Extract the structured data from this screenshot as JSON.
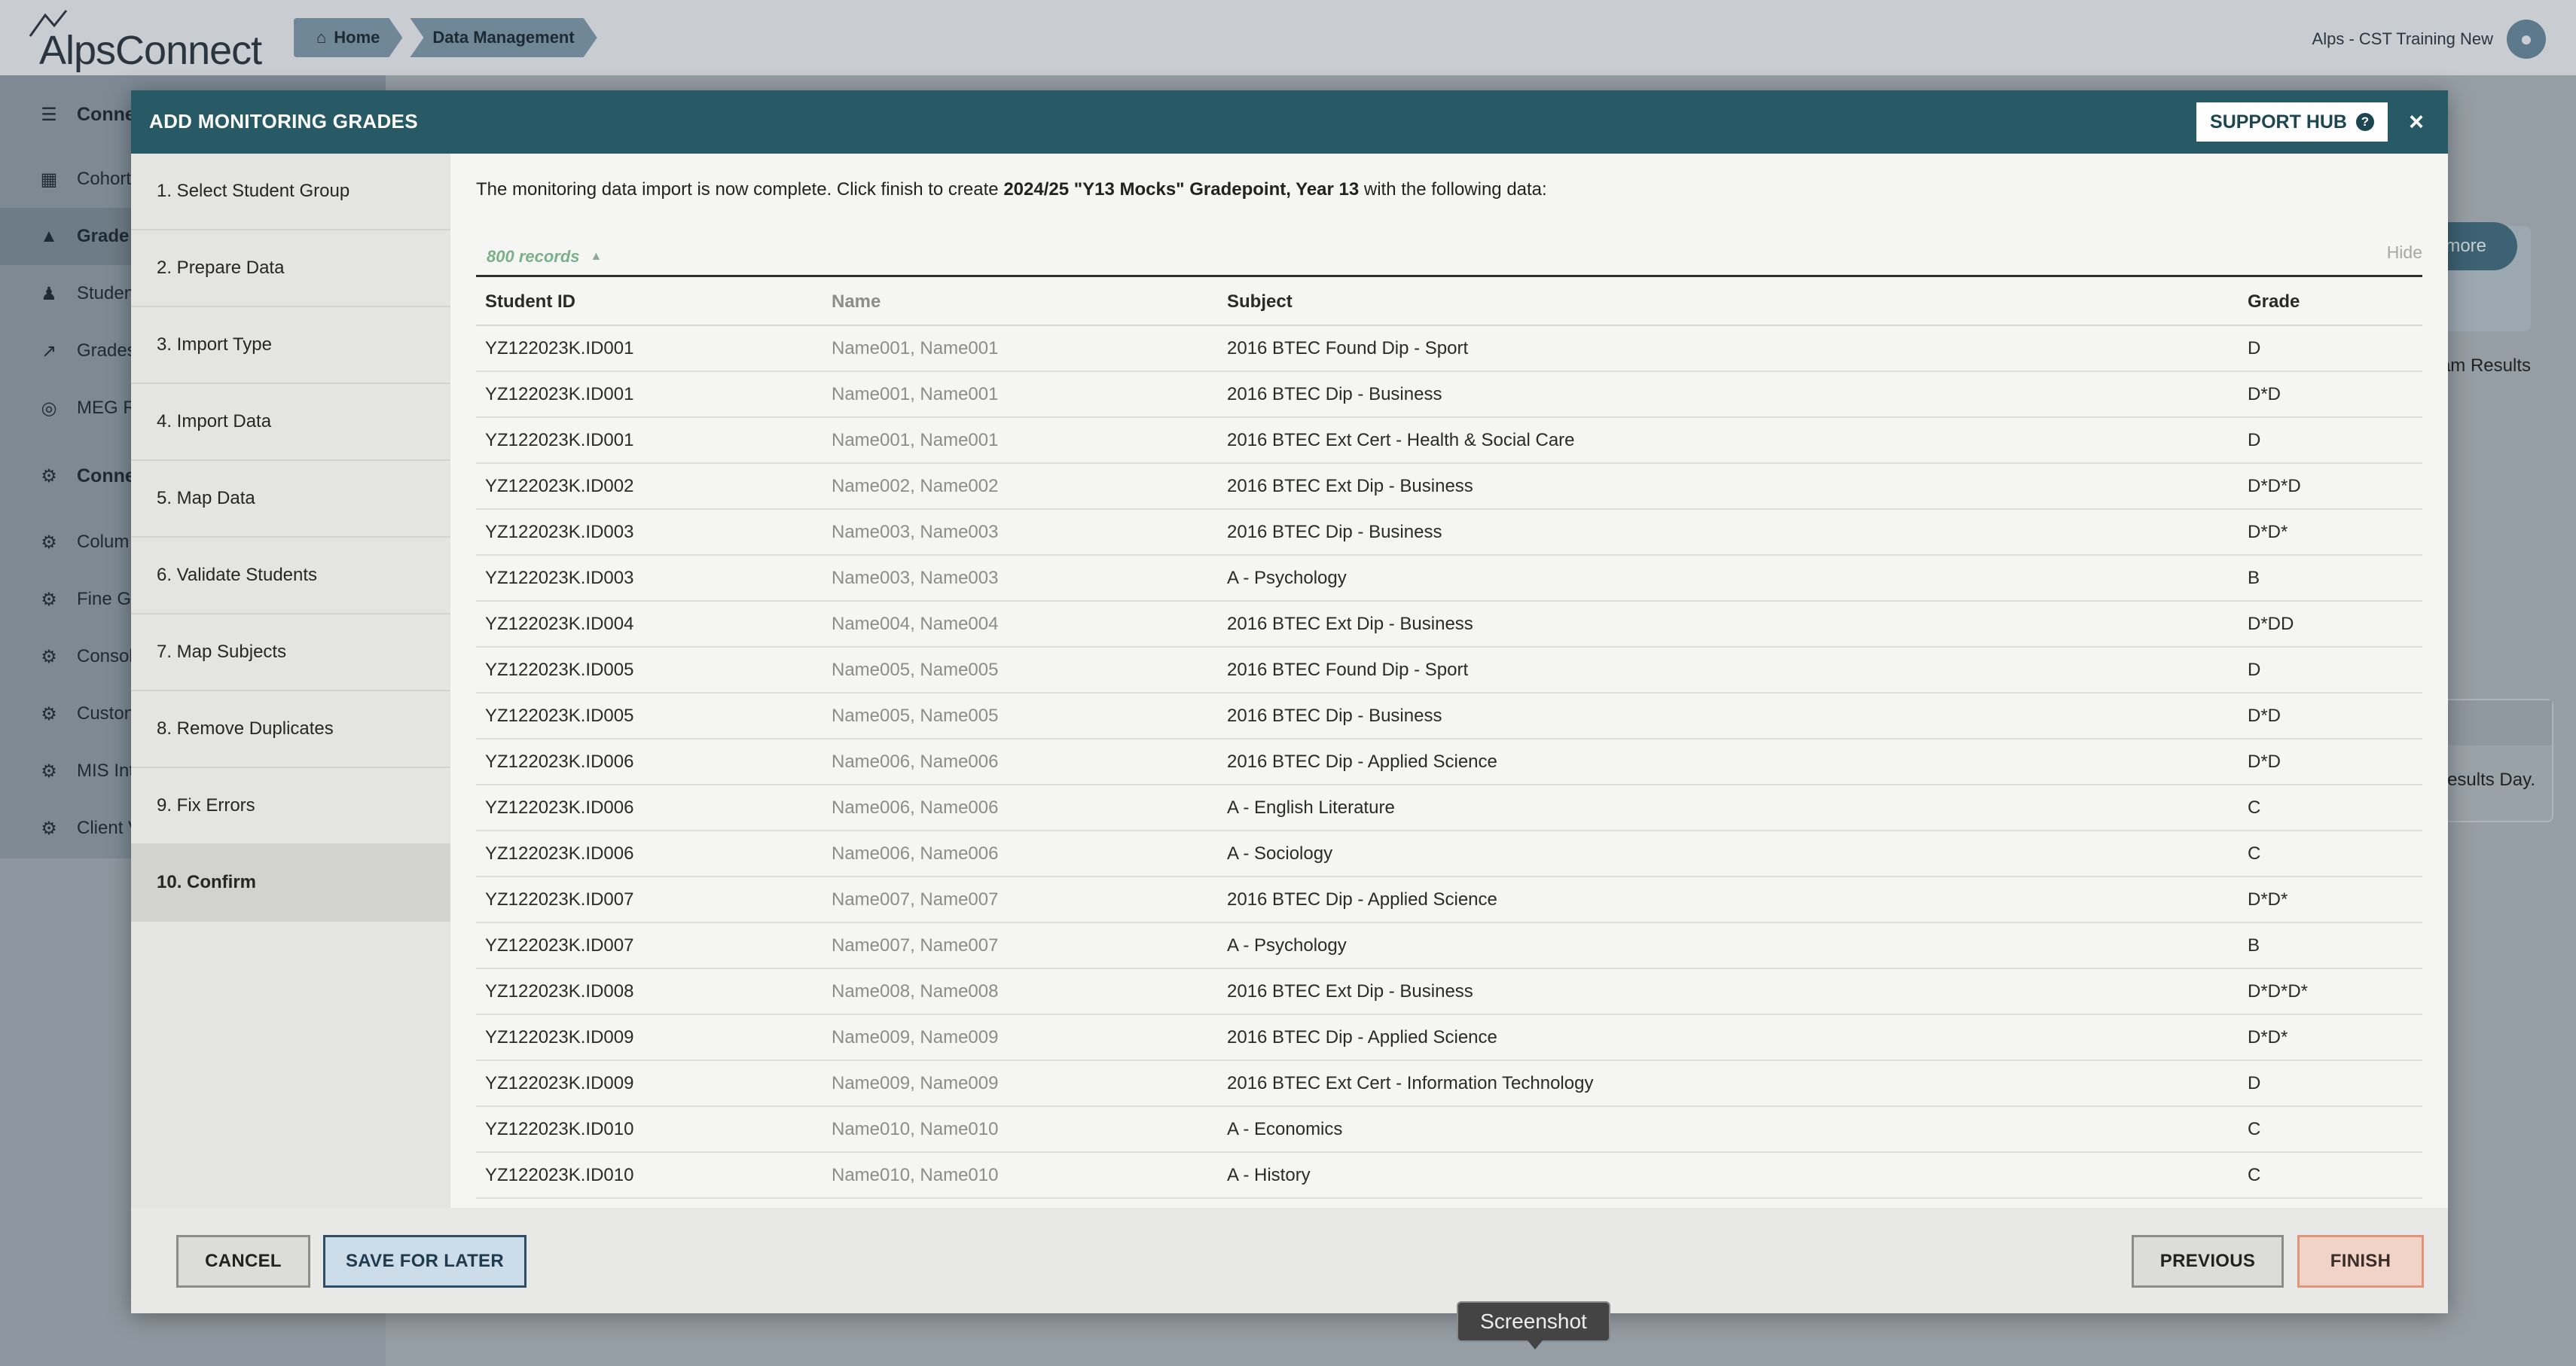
{
  "app": {
    "logo_text": "AlpsConnect",
    "breadcrumbs": [
      "Home",
      "Data Management"
    ],
    "account_name": "Alps - CST Training New"
  },
  "sidebar": {
    "items": [
      {
        "label": "Conne",
        "icon": "database-icon",
        "heading": true
      },
      {
        "label": "Cohort",
        "icon": "table-icon"
      },
      {
        "label": "Grade",
        "icon": "graduation-cap-icon",
        "selected": true
      },
      {
        "label": "Studen",
        "icon": "student-icon"
      },
      {
        "label": "Grades",
        "icon": "line-chart-icon"
      },
      {
        "label": "MEG R",
        "icon": "target-icon"
      },
      {
        "label": "Conne",
        "icon": "gear-icon",
        "heading": true
      },
      {
        "label": "Colum",
        "icon": "gear-icon"
      },
      {
        "label": "Fine Gi",
        "icon": "gear-icon"
      },
      {
        "label": "Consol",
        "icon": "gear-icon"
      },
      {
        "label": "Custon",
        "icon": "gear-icon"
      },
      {
        "label": "MIS Int",
        "icon": "gear-icon"
      },
      {
        "label": "Client V",
        "icon": "gear-icon"
      }
    ]
  },
  "background": {
    "more_button": "t more",
    "tab_label": "am Results",
    "card_text": "esults Day."
  },
  "modal": {
    "title": "ADD MONITORING GRADES",
    "support_label": "SUPPORT HUB",
    "close_symbol": "×",
    "steps": [
      "1. Select Student Group",
      "2. Prepare Data",
      "3. Import Type",
      "4. Import Data",
      "5. Map Data",
      "6. Validate Students",
      "7. Map Subjects",
      "8. Remove Duplicates",
      "9. Fix Errors",
      "10. Confirm"
    ],
    "active_step": 9,
    "intro_prefix": "The monitoring data import is now complete. Click finish to create ",
    "intro_bold": "2024/25 \"Y13 Mocks\" Gradepoint, Year 13",
    "intro_suffix": " with the following data:",
    "records_label": "800 records",
    "hide_label": "Hide",
    "table": {
      "columns": [
        "Student ID",
        "Name",
        "Subject",
        "Grade"
      ],
      "rows": [
        [
          "YZ122023K.ID001",
          "Name001, Name001",
          "2016 BTEC Found Dip - Sport",
          "D"
        ],
        [
          "YZ122023K.ID001",
          "Name001, Name001",
          "2016 BTEC Dip - Business",
          "D*D"
        ],
        [
          "YZ122023K.ID001",
          "Name001, Name001",
          "2016 BTEC Ext Cert - Health & Social Care",
          "D"
        ],
        [
          "YZ122023K.ID002",
          "Name002, Name002",
          "2016 BTEC Ext Dip - Business",
          "D*D*D"
        ],
        [
          "YZ122023K.ID003",
          "Name003, Name003",
          "2016 BTEC Dip - Business",
          "D*D*"
        ],
        [
          "YZ122023K.ID003",
          "Name003, Name003",
          "A - Psychology",
          "B"
        ],
        [
          "YZ122023K.ID004",
          "Name004, Name004",
          "2016 BTEC Ext Dip - Business",
          "D*DD"
        ],
        [
          "YZ122023K.ID005",
          "Name005, Name005",
          "2016 BTEC Found Dip - Sport",
          "D"
        ],
        [
          "YZ122023K.ID005",
          "Name005, Name005",
          "2016 BTEC Dip - Business",
          "D*D"
        ],
        [
          "YZ122023K.ID006",
          "Name006, Name006",
          "2016 BTEC Dip - Applied Science",
          "D*D"
        ],
        [
          "YZ122023K.ID006",
          "Name006, Name006",
          "A - English Literature",
          "C"
        ],
        [
          "YZ122023K.ID006",
          "Name006, Name006",
          "A - Sociology",
          "C"
        ],
        [
          "YZ122023K.ID007",
          "Name007, Name007",
          "2016 BTEC Dip - Applied Science",
          "D*D*"
        ],
        [
          "YZ122023K.ID007",
          "Name007, Name007",
          "A - Psychology",
          "B"
        ],
        [
          "YZ122023K.ID008",
          "Name008, Name008",
          "2016 BTEC Ext Dip - Business",
          "D*D*D*"
        ],
        [
          "YZ122023K.ID009",
          "Name009, Name009",
          "2016 BTEC Dip - Applied Science",
          "D*D*"
        ],
        [
          "YZ122023K.ID009",
          "Name009, Name009",
          "2016 BTEC Ext Cert - Information Technology",
          "D"
        ],
        [
          "YZ122023K.ID010",
          "Name010, Name010",
          "A - Economics",
          "C"
        ],
        [
          "YZ122023K.ID010",
          "Name010, Name010",
          "A - History",
          "C"
        ]
      ]
    },
    "footer": {
      "cancel": "CANCEL",
      "save_for_later": "SAVE FOR LATER",
      "previous": "PREVIOUS",
      "finish": "FINISH"
    }
  },
  "tooltip": "Screenshot",
  "colors": {
    "modal_header": "#285a66",
    "records_green": "#7ab08a",
    "finish_border": "#e1947c",
    "save_border": "#2c4d63"
  }
}
